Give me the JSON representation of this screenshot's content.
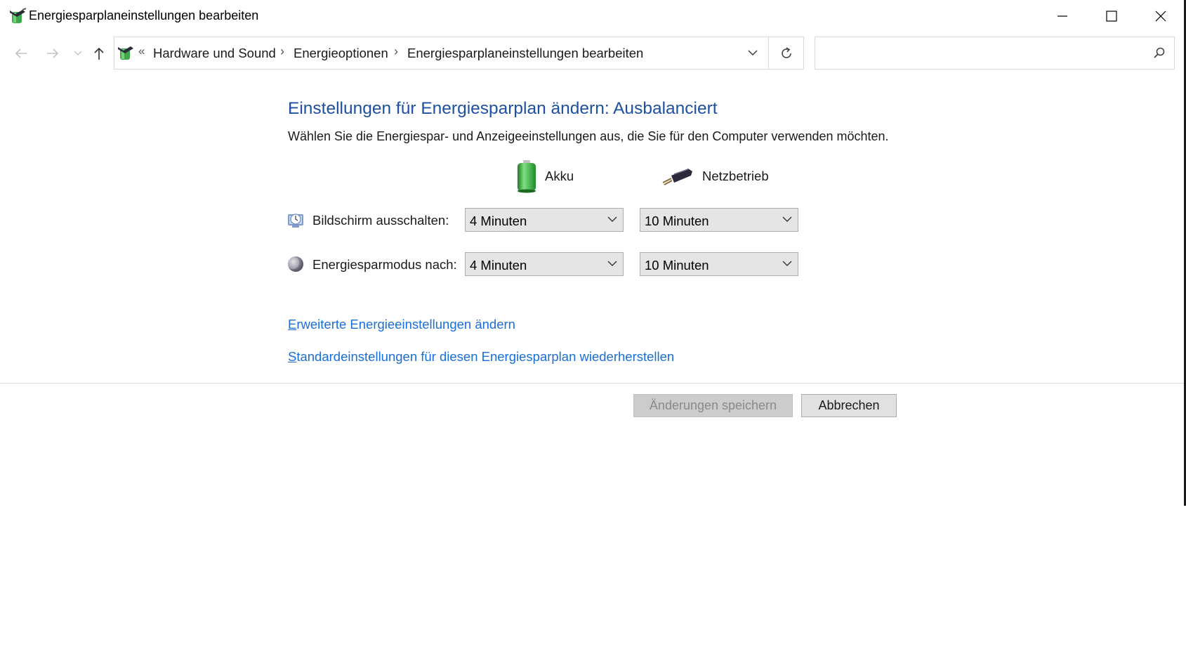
{
  "window": {
    "title": "Energiesparplaneinstellungen bearbeiten",
    "icon": "power-options-icon",
    "controls": [
      "minimize-icon",
      "maximize-icon",
      "close-icon"
    ]
  },
  "navigation": {
    "back_icon": "back-arrow-icon",
    "forward_icon": "forward-arrow-icon",
    "recent_icon": "chevron-down-icon",
    "up_icon": "up-arrow-icon",
    "overflow": "«",
    "breadcrumbs": [
      {
        "label": "Hardware und Sound"
      },
      {
        "label": "Energieoptionen"
      },
      {
        "label": "Energiesparplaneinstellungen bearbeiten"
      }
    ],
    "search_placeholder": ""
  },
  "main": {
    "title": "Einstellungen für Energiesparplan ändern: Ausbalanciert",
    "subtitle": "Wählen Sie die Energiespar- und Anzeigeeinstellungen aus, die Sie für den Computer verwenden möchten.",
    "columns": {
      "battery": "Akku",
      "plugged_in": "Netzbetrieb"
    },
    "settings": [
      {
        "label": "Bildschirm ausschalten:",
        "icon": "display-icon",
        "battery_value": "4 Minuten",
        "plugged_value": "10 Minuten"
      },
      {
        "label": "Energiesparmodus nach:",
        "icon": "sleep-moon-icon",
        "battery_value": "4 Minuten",
        "plugged_value": "10 Minuten"
      }
    ],
    "links": {
      "advanced_first": "E",
      "advanced_rest": "rweiterte Energieeinstellungen ändern",
      "restore_first": "S",
      "restore_rest": "tandardeinstellungen für diesen Energiesparplan wiederherstellen"
    }
  },
  "buttons": {
    "save": "Änderungen speichern",
    "cancel": "Abbrechen"
  },
  "colors": {
    "title_blue": "#1e50a2",
    "link_blue": "#1a6ed8",
    "battery_green": "#3cb043"
  }
}
